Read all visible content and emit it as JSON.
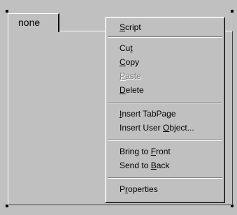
{
  "tab_control": {
    "tabs": [
      {
        "label": "none",
        "selected": true
      }
    ]
  },
  "context_menu": {
    "items": [
      {
        "label": "Script",
        "mnemonic": "S",
        "enabled": true
      },
      {
        "label": "Cut",
        "mnemonic": "t",
        "enabled": true
      },
      {
        "label": "Copy",
        "mnemonic": "C",
        "enabled": true
      },
      {
        "label": "Paste",
        "mnemonic": "P",
        "enabled": false
      },
      {
        "label": "Delete",
        "mnemonic": "D",
        "enabled": true
      },
      {
        "label": "Insert TabPage",
        "mnemonic": "I",
        "enabled": true
      },
      {
        "label": "Insert User Object...",
        "mnemonic": "O",
        "enabled": true
      },
      {
        "label": "Bring to Front",
        "mnemonic": "F",
        "enabled": true
      },
      {
        "label": "Send to Back",
        "mnemonic": "B",
        "enabled": true
      },
      {
        "label": "Properties",
        "mnemonic": "r",
        "enabled": true
      }
    ]
  },
  "colors": {
    "face": "#c0c0c0",
    "highlight": "#ffffff",
    "shadow": "#808080",
    "dark": "#000000",
    "disabled_text": "#808080"
  }
}
